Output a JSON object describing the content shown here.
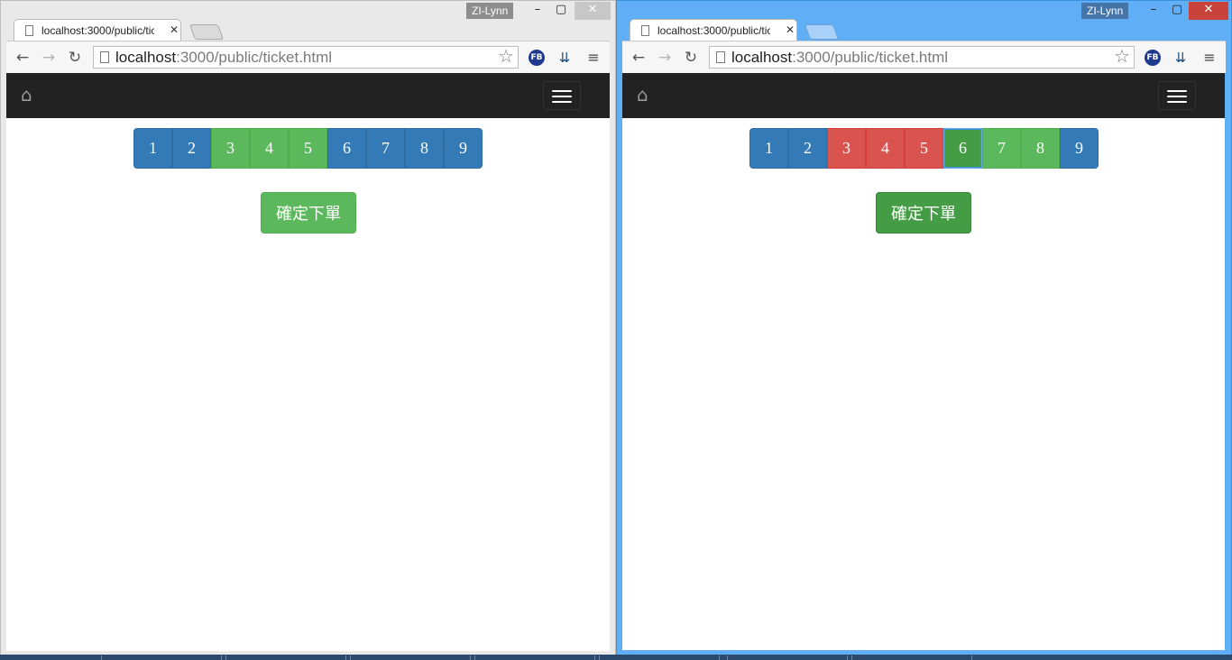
{
  "user_name": "ZI-Lynn",
  "windows": [
    {
      "id": "left",
      "tab_title": "localhost:3000/public/tic",
      "url_host": "localhost",
      "url_path": ":3000/public/ticket.html",
      "seats": [
        {
          "label": "1",
          "state": "blue"
        },
        {
          "label": "2",
          "state": "blue"
        },
        {
          "label": "3",
          "state": "green"
        },
        {
          "label": "4",
          "state": "green"
        },
        {
          "label": "5",
          "state": "green"
        },
        {
          "label": "6",
          "state": "blue"
        },
        {
          "label": "7",
          "state": "blue"
        },
        {
          "label": "8",
          "state": "blue"
        },
        {
          "label": "9",
          "state": "blue"
        }
      ],
      "order_button": "確定下單"
    },
    {
      "id": "right",
      "tab_title": "localhost:3000/public/tic",
      "url_host": "localhost",
      "url_path": ":3000/public/ticket.html",
      "seats": [
        {
          "label": "1",
          "state": "blue"
        },
        {
          "label": "2",
          "state": "blue"
        },
        {
          "label": "3",
          "state": "red"
        },
        {
          "label": "4",
          "state": "red"
        },
        {
          "label": "5",
          "state": "red"
        },
        {
          "label": "6",
          "state": "darkgreen"
        },
        {
          "label": "7",
          "state": "green"
        },
        {
          "label": "8",
          "state": "green"
        },
        {
          "label": "9",
          "state": "blue"
        }
      ],
      "order_button": "確定下單"
    }
  ],
  "icons": {
    "home": "home-icon",
    "menu": "hamburger-menu-icon",
    "extension_fb": "FB",
    "colors": {
      "blue": "#337ab7",
      "green": "#5cb85c",
      "red": "#d9534f",
      "darkgreen": "#449d44",
      "navbar": "#222222"
    }
  }
}
